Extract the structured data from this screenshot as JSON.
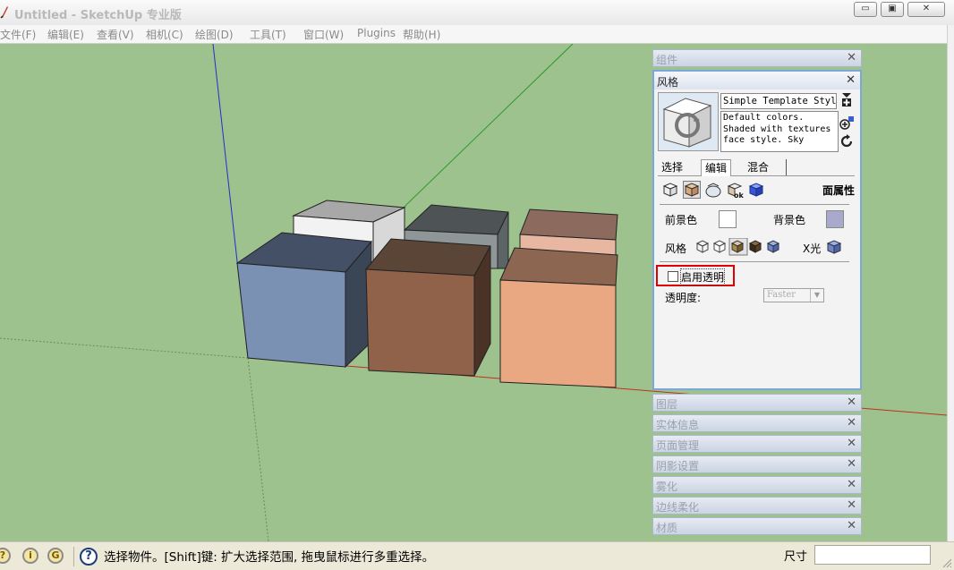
{
  "window": {
    "title": "Untitled - SketchUp 专业版",
    "controls": [
      "minimize",
      "maximize",
      "close"
    ]
  },
  "menu": [
    "文件(F)",
    "编辑(E)",
    "查看(V)",
    "相机(C)",
    "绘图(D)",
    "工具(T)",
    "窗口(W)",
    "Plugins",
    "帮助(H)"
  ],
  "tray": {
    "components_title": "组件",
    "styles": {
      "title": "风格",
      "style_name": "Simple Template Style",
      "description": [
        "Default colors.",
        "Shaded with textures",
        "face style.  Sky"
      ],
      "tabs": [
        "选择",
        "编辑",
        "混合"
      ],
      "active_tab": "编辑",
      "section_label": "面属性",
      "front_color_label": "前景色",
      "back_color_label": "背景色",
      "front_color": "#ffffff",
      "back_color": "#a9a9cc",
      "style_row_label": "风格",
      "xray_label": "X光",
      "transparency_checkbox": "启用透明",
      "transparency_checked": false,
      "transparency_quality_label": "透明度:",
      "transparency_quality_value": "Faster"
    },
    "collapsed_panels": [
      "图层",
      "实体信息",
      "页面管理",
      "阴影设置",
      "雾化",
      "边线柔化",
      "材质"
    ]
  },
  "status": {
    "message": "选择物件。[Shift]键: 扩大选择范围, 拖曳鼠标进行多重选择。",
    "measurements_label": "尺寸",
    "measurements_value": ""
  },
  "colors": {
    "viewport_bg": "#9dc28e",
    "highlight_border": "#e00000",
    "panel_border": "#7da7d9"
  }
}
